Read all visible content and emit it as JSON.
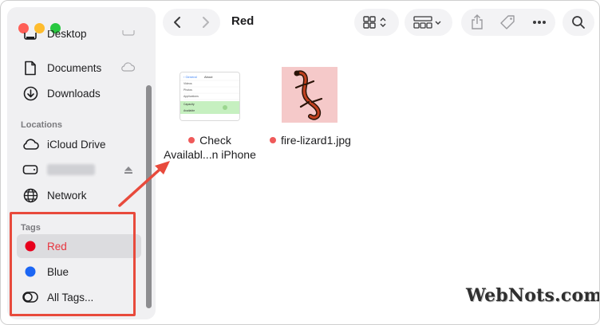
{
  "window": {
    "title": "Red"
  },
  "sidebar": {
    "favorites": [
      {
        "label": "Desktop",
        "icon": "desktop-icon"
      },
      {
        "label": "Documents",
        "icon": "document-icon"
      },
      {
        "label": "Downloads",
        "icon": "download-icon"
      }
    ],
    "locations_title": "Locations",
    "locations": [
      {
        "label": "iCloud Drive",
        "icon": "cloud-icon"
      },
      {
        "label": "",
        "icon": "drive-icon"
      },
      {
        "label": "Network",
        "icon": "globe-icon"
      }
    ],
    "tags_title": "Tags",
    "tags": [
      {
        "label": "Red",
        "color": "#e8001c",
        "selected": true
      },
      {
        "label": "Blue",
        "color": "#1c66f4",
        "selected": false
      },
      {
        "label": "All Tags...",
        "icon": "all-tags-icon",
        "selected": false
      }
    ]
  },
  "files": [
    {
      "name_line1": "Check",
      "name_line2": "Availabl...n iPhone",
      "tag_color": "#ef5a5a",
      "thumbnail": "iphone-storage-screenshot"
    },
    {
      "name_line1": "fire-lizard1.jpg",
      "tag_color": "#ef5a5a",
      "thumbnail": "fire-lizard-image"
    }
  ],
  "annotation": {
    "highlight_color": "#e84a3c"
  },
  "watermark": {
    "text": "WebNots.com"
  }
}
